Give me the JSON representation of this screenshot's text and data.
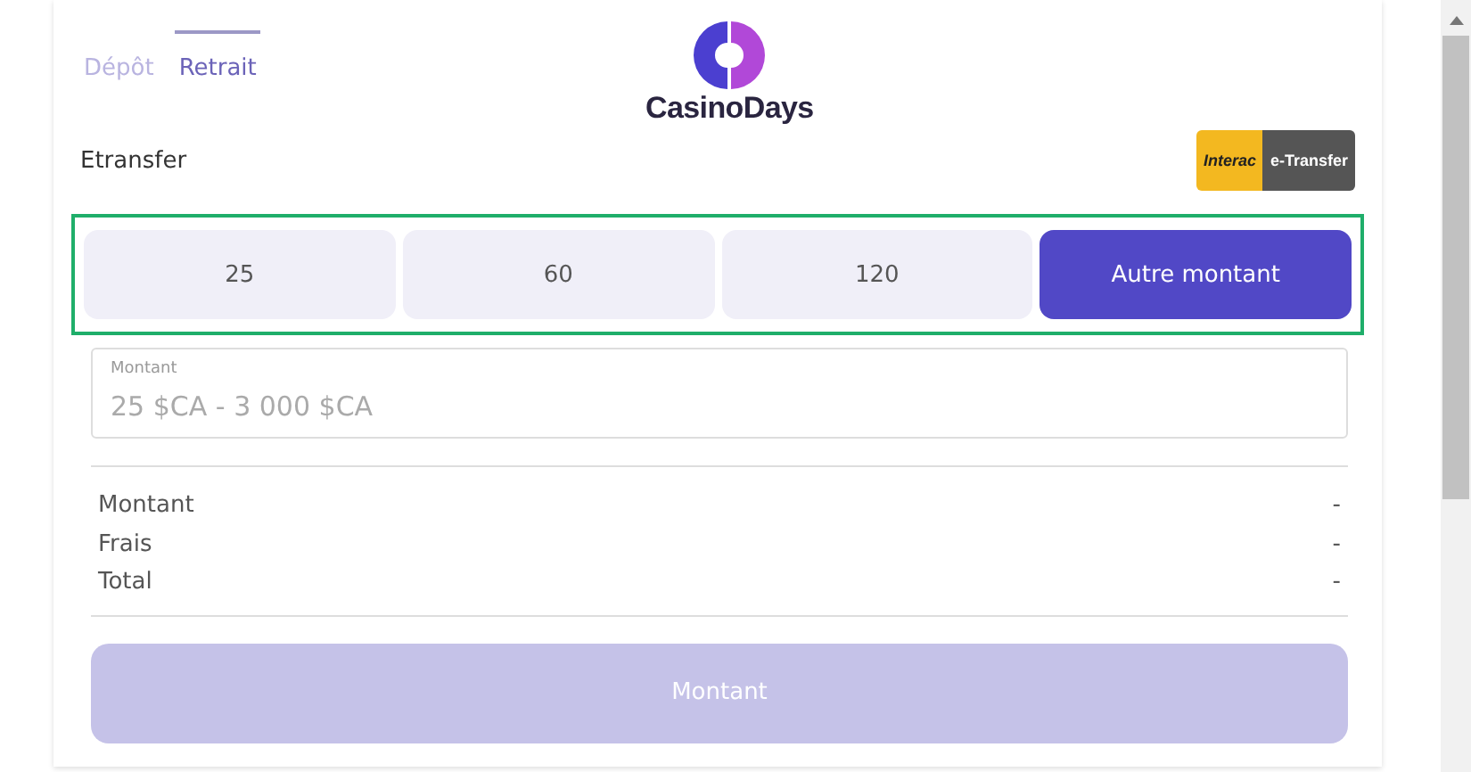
{
  "tabs": [
    {
      "label": "Dépôt",
      "selected": false
    },
    {
      "label": "Retrait",
      "selected": true
    }
  ],
  "logo": {
    "text": "CasinoDays"
  },
  "method": {
    "name": "Etransfer",
    "badge_left": "Interac",
    "badge_right": "e-Transfer"
  },
  "amount_options": {
    "highlighted": true,
    "items": [
      {
        "label": "25",
        "selected": false
      },
      {
        "label": "60",
        "selected": false
      },
      {
        "label": "120",
        "selected": false
      },
      {
        "label": "Autre montant",
        "selected": true
      }
    ]
  },
  "amount_field": {
    "label": "Montant",
    "placeholder": "25 $CA - 3 000 $CA"
  },
  "summary": [
    {
      "label": "Montant",
      "value": "-"
    },
    {
      "label": "Frais",
      "value": "-"
    },
    {
      "label": "Total",
      "value": "-"
    }
  ],
  "submit": {
    "label": "Montant",
    "disabled": true
  }
}
